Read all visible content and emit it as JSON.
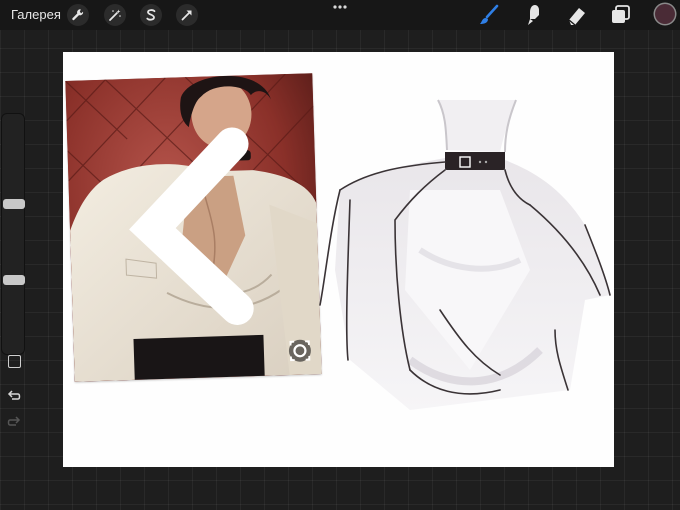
{
  "topbar": {
    "gallery_label": "Галерея",
    "left_tools": [
      {
        "icon": "wrench-icon"
      },
      {
        "icon": "magic-wand-icon"
      },
      {
        "icon": "selection-s-icon"
      },
      {
        "icon": "transform-arrow-icon"
      }
    ],
    "right_tools": [
      {
        "icon": "brush-icon",
        "active": true
      },
      {
        "icon": "smudge-icon"
      },
      {
        "icon": "eraser-icon"
      },
      {
        "icon": "layers-icon"
      }
    ],
    "current_color": "#4a2b36",
    "accent": "#2f7fe6"
  },
  "sidebar": {
    "brush_size_level": 0.62,
    "opacity_level": 0.45
  }
}
